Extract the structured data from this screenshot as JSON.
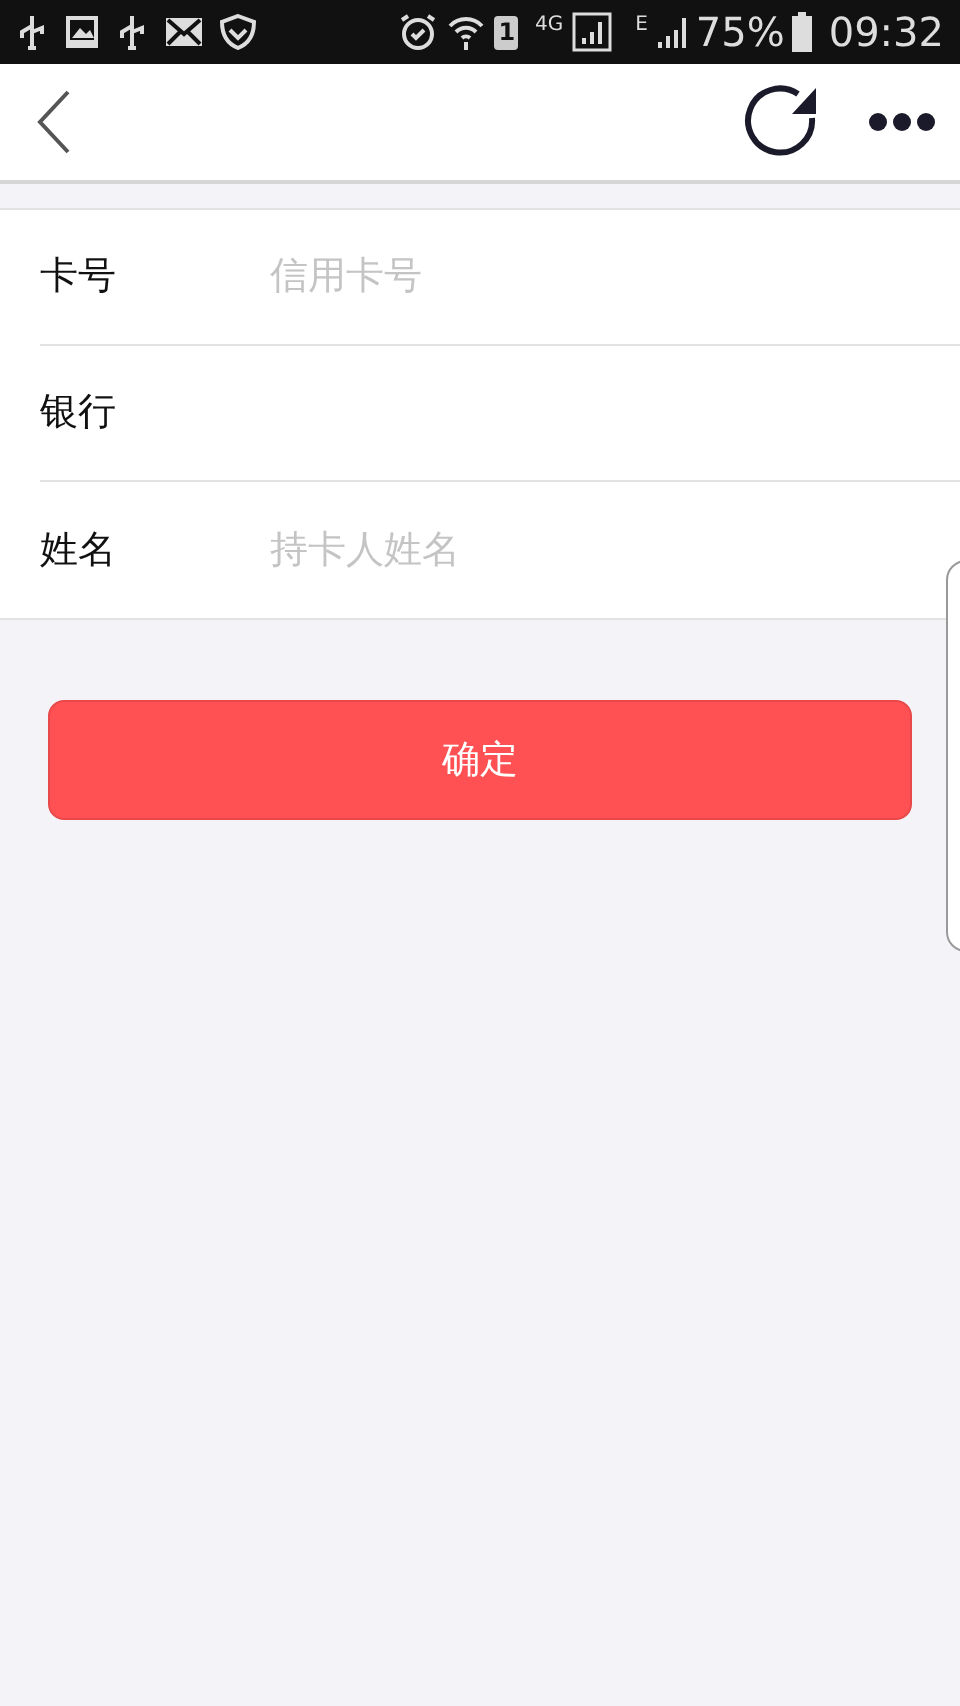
{
  "status_bar": {
    "sim": "1",
    "network": "4G",
    "network_2": "E",
    "battery": "75%",
    "time": "09:32"
  },
  "form": {
    "fields": [
      {
        "label": "卡号",
        "placeholder": "信用卡号"
      },
      {
        "label": "银行"
      },
      {
        "label": "姓名",
        "placeholder": "持卡人姓名"
      }
    ]
  },
  "submit_button": "确定"
}
